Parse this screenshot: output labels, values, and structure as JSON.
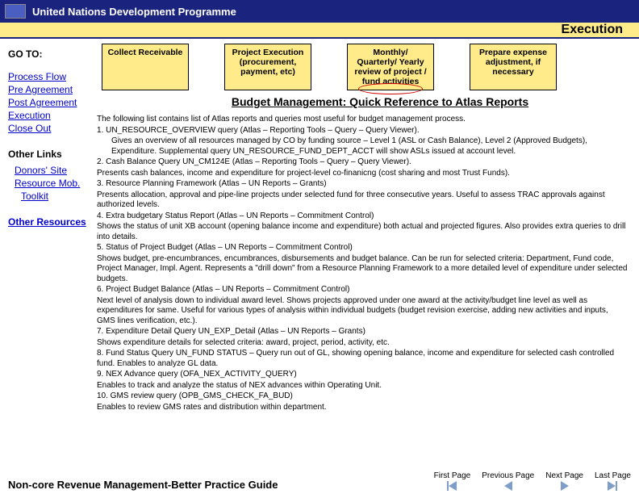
{
  "header": {
    "org": "United Nations Development Programme"
  },
  "topbar": {
    "title": "Execution"
  },
  "sidebar": {
    "goto_label": "GO TO:",
    "links": [
      "Process Flow",
      "Pre Agreement",
      "Post Agreement",
      "Execution",
      "Close Out"
    ],
    "other_links_label": "Other Links",
    "other_links": [
      "Donors' Site",
      "Resource Mob.",
      "Toolkit"
    ],
    "other_resources_label": "Other Resources"
  },
  "flow": {
    "collect": "Collect Receivable",
    "project": "Project Execution (procurement, payment, etc)",
    "review": "Monthly/ Quarterly/ Yearly review of project / fund activities",
    "adjust": "Prepare expense adjustment, if necessary"
  },
  "heading": "Budget Management: Quick Reference to Atlas Reports",
  "body": {
    "intro": "The following list contains list of Atlas reports and queries most useful for budget management process.",
    "l1": "1. UN_RESOURCE_OVERVIEW query (Atlas – Reporting Tools – Query – Query Viewer).",
    "l1a": "Gives an overview of all resources managed by CO by funding source – Level 1 (ASL or Cash Balance), Level 2 (Approved Budgets), Expenditure. Supplemental query UN_RESOURCE_FUND_DEPT_ACCT will show ASLs issued at account level.",
    "l2": "2. Cash Balance Query UN_CM124E (Atlas – Reporting Tools – Query – Query Viewer).",
    "l2a": "Presents cash balances, income and expenditure for project-level co-finanicng (cost sharing and most Trust Funds).",
    "l3": "3. Resource Planning Framework (Atlas – UN Reports – Grants)",
    "l3a": "Presents allocation, approval and pipe-line projects under selected fund for three consecutive years. Useful to assess TRAC approvals against authorized levels.",
    "l4": "4. Extra budgetary Status Report (Atlas – UN Reports – Commitment Control)",
    "l4a": "Shows the status of unit XB account (opening balance income and expenditure) both actual and projected figures. Also provides extra queries to drill into details.",
    "l5": "5. Status of Project Budget (Atlas – UN Reports – Commitment Control)",
    "l5a": "Shows budget, pre-encumbrances, encumbrances, disbursements and budget balance. Can be run for selected criteria: Department, Fund code, Project Manager, Impl. Agent. Represents a \"drill down\" from a Resource Planning Framework to a more detailed level of expenditure under selected budgets.",
    "l6": "6. Project Budget Balance (Atlas – UN Reports – Commitment Control)",
    "l6a": "Next level of analysis down to individual award level. Shows projects approved under one award at the activity/budget line level as well as expenditures for same. Useful for various types of analysis within individual budgets (budget revision exercise, adding new activities and inputs, GMS lines verification, etc.).",
    "l7": "7. Expenditure Detail Query UN_EXP_Detail (Atlas – UN Reports – Grants)",
    "l7a": "Shows expenditure details for selected criteria: award, project, period, activity, etc.",
    "l8": "8. Fund Status Query UN_FUND STATUS – Query run out of GL, showing opening balance, income and expenditure for selected cash controlled fund. Enables to analyze GL data.",
    "l9": "9. NEX Advance query (OFA_NEX_ACTIVITY_QUERY)",
    "l9a": "Enables to track and analyze the status of NEX advances within Operating Unit.",
    "l10": "10. GMS review query (OPB_GMS_CHECK_FA_BUD)",
    "l10a": "Enables to review GMS rates and distribution within department."
  },
  "footer": {
    "title": "Non-core Revenue Management-Better Practice Guide",
    "nav": {
      "first": "First Page",
      "prev": "Previous Page",
      "next": "Next Page",
      "last": "Last Page"
    }
  }
}
